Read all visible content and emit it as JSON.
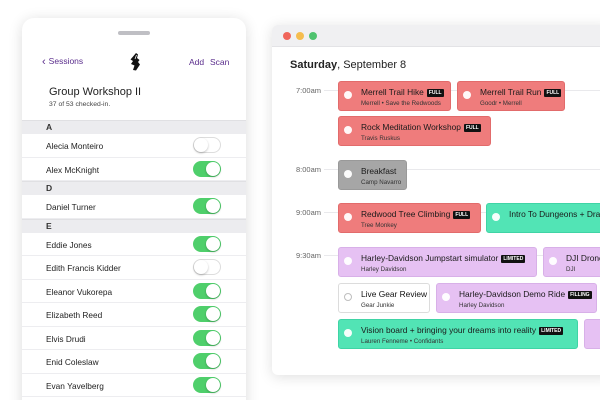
{
  "calendar": {
    "day_name": "Saturday",
    "date": ", September 8",
    "times": [
      "7:00am",
      "8:00am",
      "9:00am",
      "9:30am"
    ],
    "events": [
      {
        "title": "Merrell Trail Hike",
        "tag": "FULL",
        "sub": "Merrell • Save the Redwoods"
      },
      {
        "title": "Merrell Trail Run",
        "tag": "FULL",
        "sub": "Goodr • Merrell"
      },
      {
        "title": "Rock Meditation Workshop",
        "tag": "FULL",
        "sub": "Travis Ruskus"
      },
      {
        "title": "Breakfast",
        "tag": "",
        "sub": "Camp Navarro"
      },
      {
        "title": "Redwood Tree Climbing",
        "tag": "FULL",
        "sub": "Tree Monkey"
      },
      {
        "title": "Intro To Dungeons + Dra",
        "tag": "",
        "sub": ""
      },
      {
        "title": "Harley-Davidson Jumpstart simulator",
        "tag": "LIMITED",
        "sub": "Harley Davidson"
      },
      {
        "title": "DJI Drone",
        "tag": "",
        "sub": "DJI"
      },
      {
        "title": "Live Gear Review",
        "tag": "",
        "sub": "Gear Junkie"
      },
      {
        "title": "Harley-Davidson Demo Ride",
        "tag": "FILLING",
        "sub": "Harley Davidson"
      },
      {
        "title": "Vision board + bringing your dreams into reality",
        "tag": "LIMITED",
        "sub": "Lauren Fenneme • Confidants"
      }
    ],
    "colors": {
      "red": "#ef7c7c",
      "teal": "#52e4b5",
      "lilac": "#e6c1f3",
      "gray": "#a6a6a6"
    }
  },
  "checkin": {
    "back_label": "Sessions",
    "add_label": "Add",
    "scan_label": "Scan",
    "logo_icon": "shoe-logo-icon",
    "title": "Group Workshop II",
    "subtitle": "37 of 53 checked-in.",
    "sections": [
      {
        "letter": "A",
        "people": [
          {
            "name": "Alecia Monteiro",
            "checked": false
          },
          {
            "name": "Alex McKnight",
            "checked": true
          }
        ]
      },
      {
        "letter": "D",
        "people": [
          {
            "name": "Daniel Turner",
            "checked": true
          }
        ]
      },
      {
        "letter": "E",
        "people": [
          {
            "name": "Eddie Jones",
            "checked": true
          },
          {
            "name": "Edith Francis Kidder",
            "checked": false
          },
          {
            "name": "Eleanor Vukorepa",
            "checked": true
          },
          {
            "name": "Elizabeth Reed",
            "checked": true
          },
          {
            "name": "Elvis Drudi",
            "checked": true
          },
          {
            "name": "Enid Coleslaw",
            "checked": true
          },
          {
            "name": "Evan Yavelberg",
            "checked": true
          }
        ]
      }
    ],
    "toggle_on_color": "#4fcf6b"
  }
}
